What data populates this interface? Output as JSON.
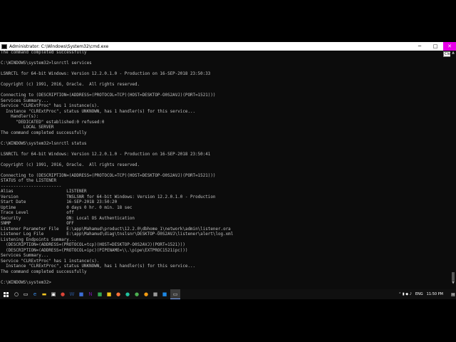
{
  "window": {
    "title": "Administrator: C:\\Windows\\System32\\cmd.exe",
    "minimize_glyph": "─",
    "maximize_glyph": "□",
    "close_glyph": "✕",
    "close_tooltip": "Close",
    "close_color": "#e800e8"
  },
  "console": {
    "lines": [
      "The command completed successfully",
      "",
      "C:\\WINDOWS\\system32>lsnrctl services",
      "",
      "LSNRCTL for 64-bit Windows: Version 12.2.0.1.0 - Production on 16-SEP-2018 23:50:33",
      "",
      "Copyright (c) 1991, 2016, Oracle.  All rights reserved.",
      "",
      "Connecting to (DESCRIPTION=(ADDRESS=(PROTOCOL=TCP)(HOST=DESKTOP-O0S2AVJ)(PORT=1521)))",
      "Services Summary...",
      "Service \"CLRExtProc\" has 1 instance(s).",
      "  Instance \"CLRExtProc\", status UNKNOWN, has 1 handler(s) for this service...",
      "    Handler(s):",
      "      \"DEDICATED\" established:0 refused:0",
      "         LOCAL SERVER",
      "The command completed successfully",
      "",
      "C:\\WINDOWS\\system32>lsnrctl status",
      "",
      "LSNRCTL for 64-bit Windows: Version 12.2.0.1.0 - Production on 16-SEP-2018 23:50:41",
      "",
      "Copyright (c) 1991, 2016, Oracle.  All rights reserved.",
      "",
      "Connecting to (DESCRIPTION=(ADDRESS=(PROTOCOL=TCP)(HOST=DESKTOP-O0S2AVJ)(PORT=1521)))",
      "STATUS of the LISTENER",
      "------------------------",
      "Alias                     LISTENER",
      "Version                   TNSLSNR for 64-bit Windows: Version 12.2.0.1.0 - Production",
      "Start Date                16-SEP-2018 23:50:20",
      "Uptime                    0 days 0 hr. 0 min. 18 sec",
      "Trace Level               off",
      "Security                  ON: Local OS Authentication",
      "SNMP                      OFF",
      "Listener Parameter File   E:\\app\\Mahamud\\product\\12.2.0\\dbhome_1\\network\\admin\\listener.ora",
      "Listener Log File         E:\\app\\Mahamud\\diag\\tnslsnr\\DESKTOP-O0S2AVJ\\listener\\alert\\log.xml",
      "Listening Endpoints Summary...",
      "  (DESCRIPTION=(ADDRESS=(PROTOCOL=tcp)(HOST=DESKTOP-O0S2AVJ)(PORT=1521)))",
      "  (DESCRIPTION=(ADDRESS=(PROTOCOL=ipc)(PIPENAME=\\\\.\\pipe\\EXTPROC1521ipc)))",
      "Services Summary...",
      "Service \"CLRExtProc\" has 1 instance(s).",
      "  Instance \"CLRExtProc\", status UNKNOWN, has 1 handler(s) for this service...",
      "The command completed successfully",
      "",
      "C:\\WINDOWS\\system32>"
    ]
  },
  "taskbar": {
    "start_icon": "windows-logo",
    "apps": [
      {
        "name": "search",
        "glyph": "○",
        "color": "#ffffff"
      },
      {
        "name": "task-view",
        "glyph": "▭",
        "color": "#ffffff"
      },
      {
        "name": "edge",
        "glyph": "e",
        "color": "#3c8ce7"
      },
      {
        "name": "file-explorer",
        "glyph": "▬",
        "color": "#f3c623"
      },
      {
        "name": "store",
        "glyph": "▣",
        "color": "#ffffff"
      },
      {
        "name": "chrome",
        "glyph": "●",
        "color": "#db4437"
      },
      {
        "name": "word",
        "glyph": "W",
        "color": "#2b579a"
      },
      {
        "name": "app-blue",
        "glyph": "■",
        "color": "#3c6ed6"
      },
      {
        "name": "onenote",
        "glyph": "N",
        "color": "#7719aa"
      },
      {
        "name": "app-green",
        "glyph": "■",
        "color": "#33a852"
      },
      {
        "name": "app-yellow",
        "glyph": "■",
        "color": "#f0c419"
      },
      {
        "name": "firefox",
        "glyph": "●",
        "color": "#ff7139"
      },
      {
        "name": "app-teal",
        "glyph": "●",
        "color": "#21c3a0"
      },
      {
        "name": "app-green2",
        "glyph": "●",
        "color": "#4caf50"
      },
      {
        "name": "app-orange",
        "glyph": "●",
        "color": "#f39c12"
      },
      {
        "name": "app-grey",
        "glyph": "■",
        "color": "#999999"
      },
      {
        "name": "app-blue2",
        "glyph": "■",
        "color": "#1e88e5"
      },
      {
        "name": "cmd",
        "glyph": "▭",
        "color": "#cccccc",
        "active": true
      }
    ],
    "tray": {
      "language": "ENG",
      "clock": "11:50 PM"
    }
  }
}
